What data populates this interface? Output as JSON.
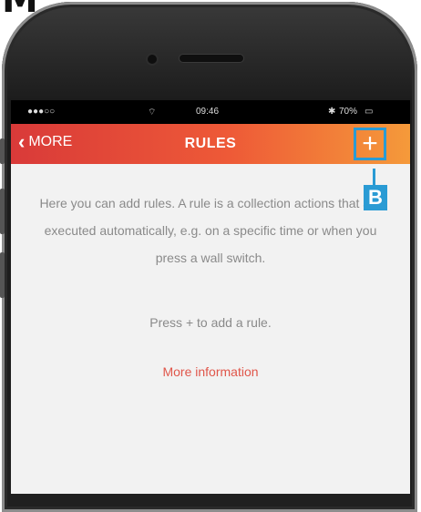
{
  "figure_label": "M",
  "callout_label": "B",
  "status_bar": {
    "carrier": "●●●○○",
    "wifi": "⌔",
    "time": "09:46",
    "bluetooth": "✱",
    "battery_pct": "70%",
    "battery_icon": "▭"
  },
  "navbar": {
    "back_label": "MORE",
    "title": "RULES",
    "add_label": "+"
  },
  "content": {
    "description": "Here you can add rules. A rule is a collection actions that are executed automatically, e.g. on a specific time or when you press a wall switch.",
    "hint": "Press + to add a rule.",
    "more_info": "More information"
  },
  "colors": {
    "navbar_gradient": [
      "#d93a39",
      "#f59a3a"
    ],
    "link": "#e0564a",
    "callout": "#2a9bd4"
  }
}
